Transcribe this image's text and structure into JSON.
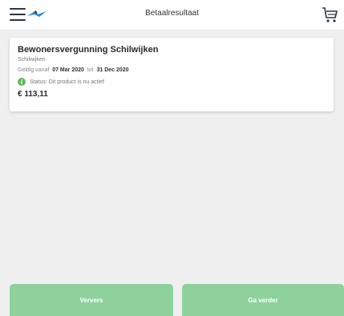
{
  "header": {
    "title": "Betaalresultaat",
    "menu_icon": "hamburger-menu-icon",
    "logo_icon": "bird-logo-icon",
    "cart_icon": "shopping-cart-icon"
  },
  "card": {
    "title": "Bewonersvergunning Schilwijken",
    "location": "Schilwijken",
    "valid_from_label": "Geldig vanaf",
    "valid_from": "07 Mar 2020",
    "valid_to_label": "tot",
    "valid_to": "31 Dec 2020",
    "status_icon": "info-icon",
    "status_text": "Status: Dit product is nu actief",
    "price": "€ 113,11"
  },
  "actions": {
    "refresh_label": "Ververs",
    "continue_label": "Ga verder"
  },
  "colors": {
    "accent_button": "#8fd19c",
    "status_green": "#5cb85c",
    "logo_blue": "#1e8fd8"
  }
}
